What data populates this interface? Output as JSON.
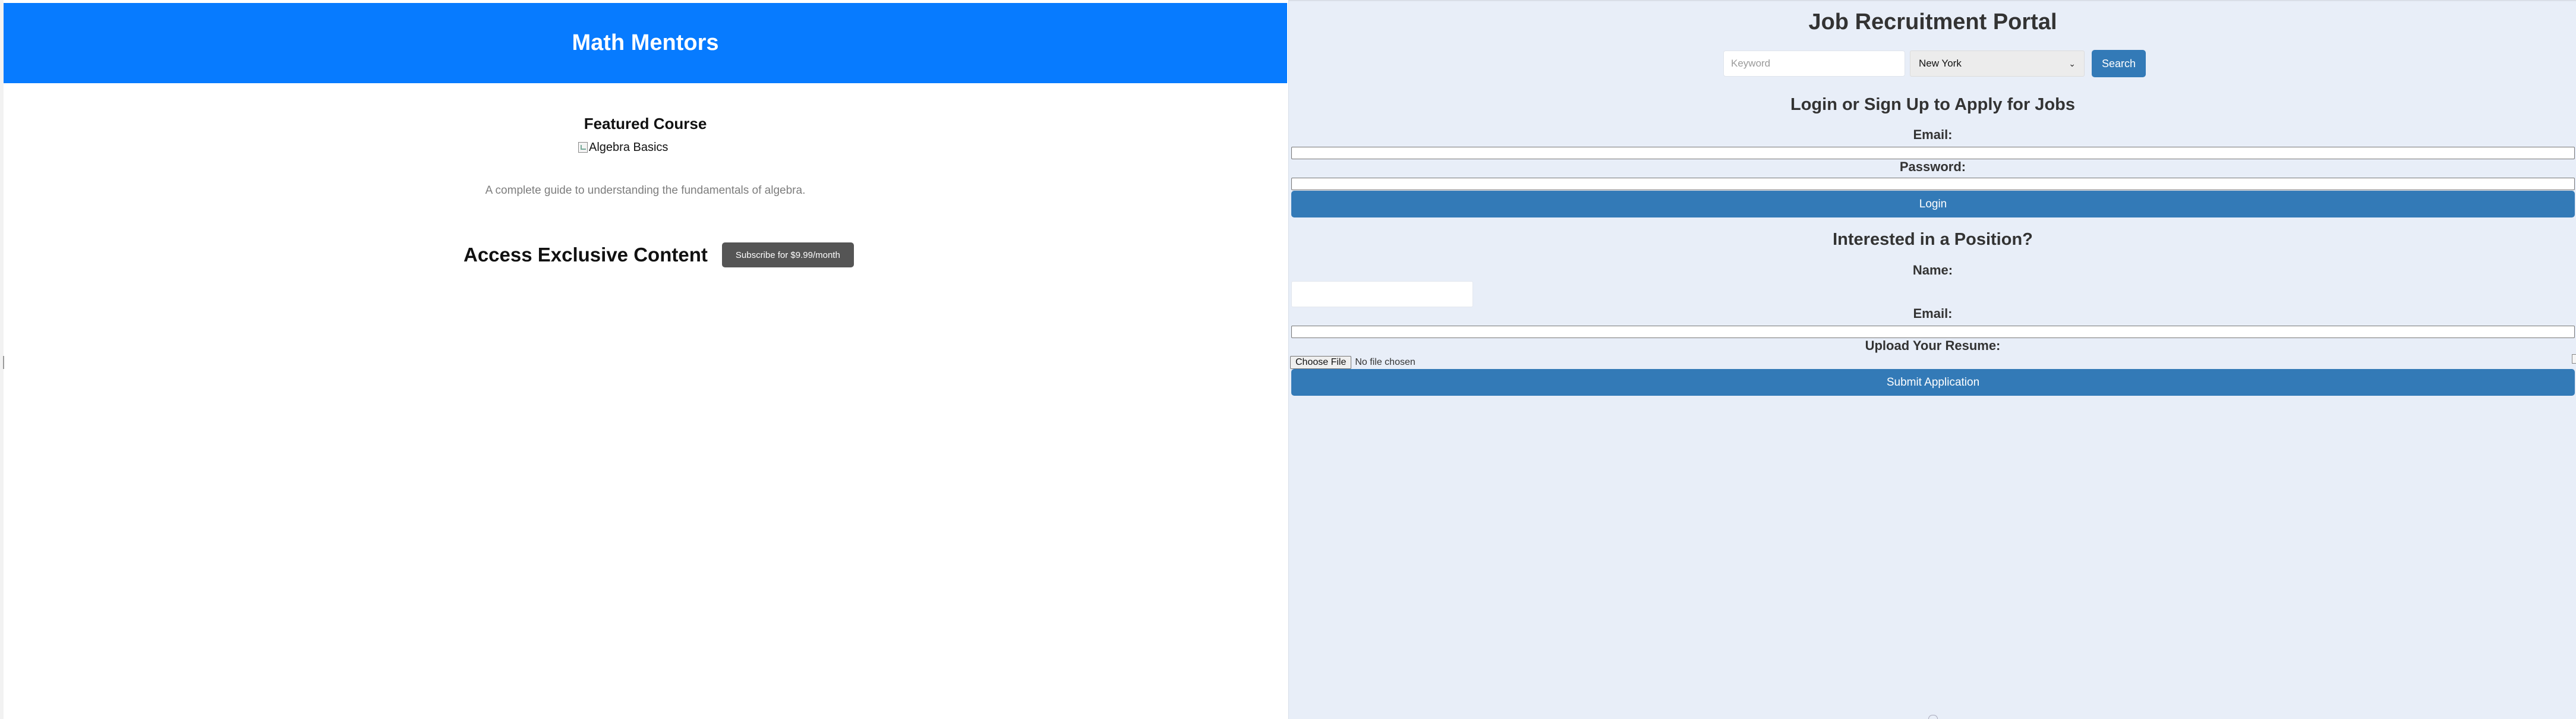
{
  "left": {
    "header": {
      "title": "Math Mentors",
      "color": "#077bff"
    },
    "featured": {
      "heading": "Featured Course",
      "image_alt": "Algebra Basics",
      "description": "A complete guide to understanding the fundamentals of algebra."
    },
    "access": {
      "heading": "Access Exclusive Content",
      "subscribe_label": "Subscribe for $9.99/month"
    }
  },
  "right": {
    "title": "Job Recruitment Portal",
    "search": {
      "keyword_placeholder": "Keyword",
      "location_selected": "New York",
      "search_label": "Search"
    },
    "login": {
      "heading": "Login or Sign Up to Apply for Jobs",
      "email_label": "Email:",
      "password_label": "Password:",
      "login_label": "Login"
    },
    "apply": {
      "heading": "Interested in a Position?",
      "name_label": "Name:",
      "email_label": "Email:",
      "resume_label": "Upload Your Resume:",
      "choose_file_label": "Choose File",
      "no_file_text": "No file chosen",
      "submit_label": "Submit Application"
    },
    "accent": "#337ab7"
  }
}
